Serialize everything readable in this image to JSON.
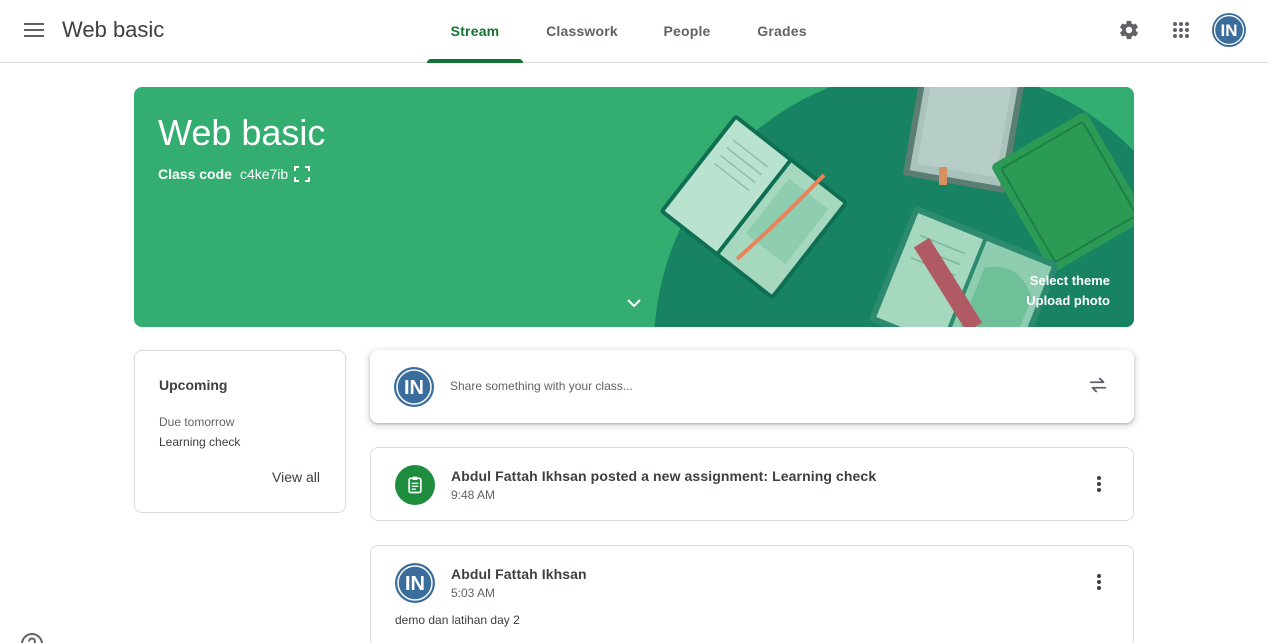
{
  "app": {
    "title": "Web basic",
    "brand_color": "#137333",
    "banner_color": "#34ad70"
  },
  "header": {
    "menu_icon": "hamburger-menu-icon",
    "tabs": [
      {
        "label": "Stream",
        "active": true
      },
      {
        "label": "Classwork",
        "active": false
      },
      {
        "label": "People",
        "active": false
      },
      {
        "label": "Grades",
        "active": false
      }
    ],
    "settings_icon": "gear-icon",
    "apps_icon": "apps-grid-icon",
    "avatar_initials": "IN"
  },
  "banner": {
    "title": "Web basic",
    "class_code_label": "Class code",
    "class_code": "c4ke7ib",
    "select_theme": "Select theme",
    "upload_photo": "Upload photo"
  },
  "upcoming": {
    "heading": "Upcoming",
    "due_text": "Due tomorrow",
    "item": "Learning check",
    "view_all": "View all"
  },
  "share": {
    "placeholder": "Share something with your class...",
    "avatar_initials": "IN"
  },
  "posts": [
    {
      "title": "Abdul Fattah Ikhsan posted a new assignment: Learning check",
      "time": "9:48 AM",
      "icon": "assignment-icon"
    },
    {
      "title": "Abdul Fattah Ikhsan",
      "time": "5:03 AM",
      "body": "demo dan latihan day 2",
      "avatar_initials": "IN"
    }
  ]
}
